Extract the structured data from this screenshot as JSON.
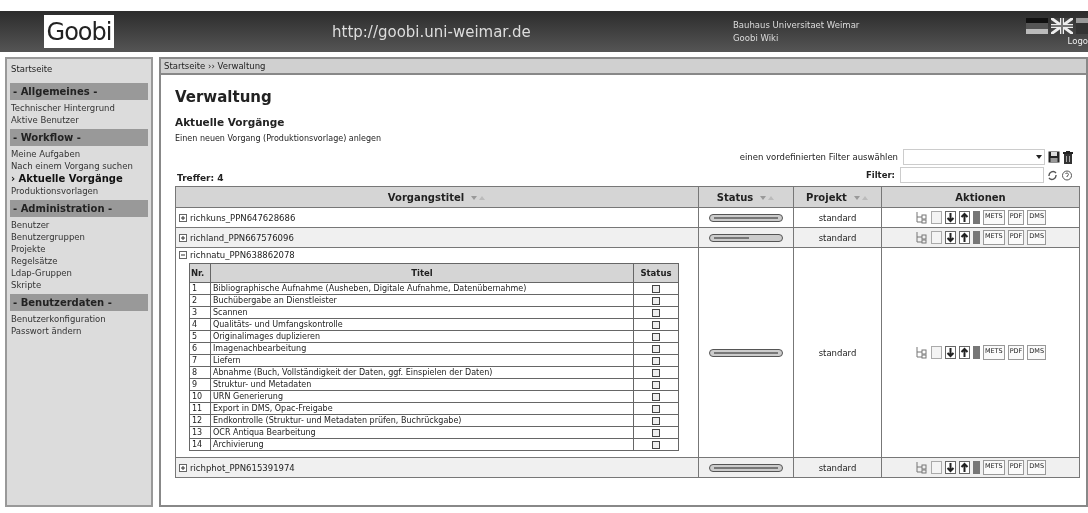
{
  "header": {
    "logo": "Goobi",
    "url": "http://goobi.uni-weimar.de",
    "links": [
      "Bauhaus Universitaet Weimar",
      "Goobi Wiki"
    ],
    "logout": "Logo"
  },
  "sidebar": {
    "home": "Startseite",
    "sections": [
      {
        "title": "- Allgemeines -",
        "items": [
          {
            "label": "Technischer Hintergrund",
            "selected": false
          },
          {
            "label": "Aktive Benutzer",
            "selected": false
          }
        ]
      },
      {
        "title": "- Workflow -",
        "items": [
          {
            "label": "Meine Aufgaben",
            "selected": false
          },
          {
            "label": "Nach einem Vorgang suchen",
            "selected": false
          },
          {
            "label": "› Aktuelle Vorgänge",
            "selected": true
          },
          {
            "label": "Produktionsvorlagen",
            "selected": false
          }
        ]
      },
      {
        "title": "- Administration -",
        "items": [
          {
            "label": "Benutzer",
            "selected": false
          },
          {
            "label": "Benutzergruppen",
            "selected": false
          },
          {
            "label": "Projekte",
            "selected": false
          },
          {
            "label": "Regelsätze",
            "selected": false
          },
          {
            "label": "Ldap-Gruppen",
            "selected": false
          },
          {
            "label": "Skripte",
            "selected": false
          }
        ]
      },
      {
        "title": "- Benutzerdaten -",
        "items": [
          {
            "label": "Benutzerkonfiguration",
            "selected": false
          },
          {
            "label": "Passwort ändern",
            "selected": false
          }
        ]
      }
    ]
  },
  "breadcrumb": "Startseite ›› Verwaltung",
  "page_title": "Verwaltung",
  "section_title": "Aktuelle Vorgänge",
  "new_link": "Einen neuen Vorgang (Produktionsvorlage) anlegen",
  "filter_select_label": "einen vordefinierten Filter auswählen",
  "filter_label": "Filter:",
  "hits": "Treffer: 4",
  "table": {
    "columns": [
      "Vorgangstitel",
      "Status",
      "Projekt",
      "Aktionen"
    ],
    "rows": [
      {
        "title": "richkuns_PPN647628686",
        "expanded": false,
        "level": 1,
        "project": "standard",
        "action_labels": [
          "METS",
          "PDF",
          "DMS"
        ]
      },
      {
        "title": "richland_PPN667576096",
        "expanded": false,
        "level": 0.55,
        "project": "standard",
        "action_labels": [
          "METS",
          "PDF",
          "DMS"
        ]
      },
      {
        "title": "richnatu_PPN638862078",
        "expanded": true,
        "level": 1,
        "project": "standard",
        "action_labels": [
          "METS",
          "PDF",
          "DMS"
        ],
        "steps": {
          "columns": [
            "Nr.",
            "Titel",
            "Status"
          ],
          "rows": [
            {
              "nr": "1",
              "title": "Bibliographische Aufnahme (Ausheben, Digitale Aufnahme, Datenübernahme)"
            },
            {
              "nr": "2",
              "title": "Buchübergabe an Dienstleister"
            },
            {
              "nr": "3",
              "title": "Scannen"
            },
            {
              "nr": "4",
              "title": "Qualitäts- und Umfangskontrolle"
            },
            {
              "nr": "5",
              "title": "Originalimages duplizieren"
            },
            {
              "nr": "6",
              "title": "Imagenachbearbeitung"
            },
            {
              "nr": "7",
              "title": "Liefern"
            },
            {
              "nr": "8",
              "title": "Abnahme (Buch, Vollständigkeit der Daten, ggf. Einspielen der Daten)"
            },
            {
              "nr": "9",
              "title": "Struktur- und Metadaten"
            },
            {
              "nr": "10",
              "title": "URN Generierung"
            },
            {
              "nr": "11",
              "title": "Export in DMS, Opac-Freigabe"
            },
            {
              "nr": "12",
              "title": "Endkontrolle (Struktur- und Metadaten prüfen, Buchrückgabe)"
            },
            {
              "nr": "13",
              "title": "OCR Antiqua Bearbeitung"
            },
            {
              "nr": "14",
              "title": "Archivierung"
            }
          ]
        }
      },
      {
        "title": "richphot_PPN615391974",
        "expanded": false,
        "level": 1,
        "project": "standard",
        "action_labels": [
          "METS",
          "PDF",
          "DMS"
        ]
      }
    ]
  }
}
